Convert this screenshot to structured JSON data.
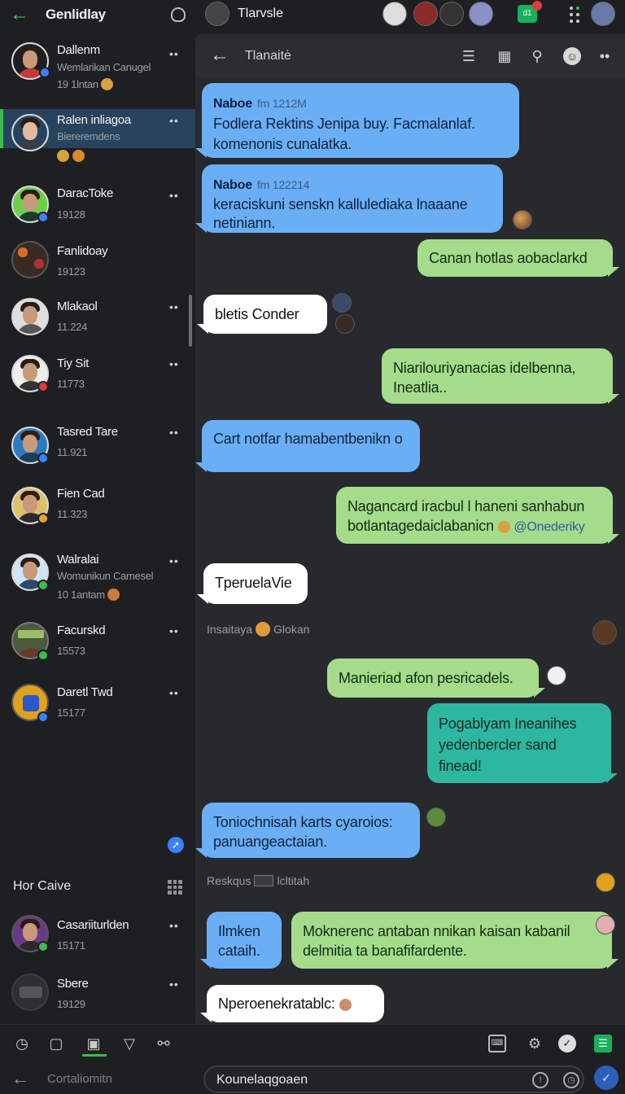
{
  "sidebar": {
    "title": "Genlidlay",
    "contacts": [
      {
        "name": "Dallenm",
        "sub": "Wemlarikan Canugel",
        "meta": "19 1lntan"
      },
      {
        "name": "Ralen inliagoa",
        "sub": "Biereremdens",
        "meta": ""
      },
      {
        "name": "DaracToke",
        "sub": "",
        "meta": "19128"
      },
      {
        "name": "Fanlidoay",
        "sub": "",
        "meta": "19123"
      },
      {
        "name": "Mlakaol",
        "sub": "",
        "meta": "11.224"
      },
      {
        "name": "Tiy Sit",
        "sub": "",
        "meta": "11773"
      },
      {
        "name": "Tasred Tare",
        "sub": "",
        "meta": "11.921"
      },
      {
        "name": "Fien Cad",
        "sub": "",
        "meta": "11.323"
      },
      {
        "name": "Walralai",
        "sub": "Womunikun Camesel",
        "meta": "10 1antam"
      },
      {
        "name": "Facurskd",
        "sub": "",
        "meta": "15573"
      },
      {
        "name": "Daretl Twd",
        "sub": "",
        "meta": "15177"
      },
      {
        "name": "Casariiturlden",
        "sub": "",
        "meta": "15171"
      },
      {
        "name": "Sbere",
        "sub": "",
        "meta": "19129"
      }
    ],
    "section_label": "Hor Caive",
    "more_label": "••"
  },
  "topbar": {
    "title": "Tlarvsle",
    "green_badge": "d1"
  },
  "chat_header": {
    "title": "Tlanaitė"
  },
  "messages": [
    {
      "sender": "Naboe",
      "time": "fm 1212M",
      "text": "Fodlera Rektins Jenipa buy. Facmalanlaf. komenonis cunalatka."
    },
    {
      "sender": "Naboe",
      "time": "fm 122214",
      "text": "keraciskuni senskn kallulediaka lnaaane netiniann."
    },
    {
      "text": "Canan hotlas aobaclarkd"
    },
    {
      "text": "bletis Conder"
    },
    {
      "text": "Niarilouriyanacias idelbenna, Ineatlia.."
    },
    {
      "text": "Cart notfar hamabentbenikn o"
    },
    {
      "text": "Nagancard iracbul l haneni sanhabun botlantagedaiclabanicn",
      "mention": "@Onederiky"
    },
    {
      "text": "TperuelaVie"
    },
    {
      "text": "Manieriad afon pesricadels."
    },
    {
      "text": "Pogablyam Ineanihes yedenbercler sand finead!"
    },
    {
      "text": "Toniochnisah karts cyaroios: panuangeactaian."
    },
    {
      "text": "Ilmken cataih."
    },
    {
      "text": "Moknerenc antaban nnikan kaisan kabanil delmitia ta banafifardente."
    },
    {
      "text": "Nperoenekratablc:"
    }
  ],
  "system_lines": [
    {
      "left": "Insaitaya",
      "right": "Glokan"
    },
    {
      "left": "Reskqus",
      "right": "lcltitah"
    }
  ],
  "input": {
    "left_text": "Cortaliomitn",
    "value": "Kounelaqgoaen"
  },
  "colors": {
    "bubble_blue": "#6aaef6",
    "bubble_green": "#a4dc8b",
    "bubble_teal": "#2eb7a0",
    "accent_green": "#3fb950",
    "accent_blue": "#3b82f6"
  },
  "icons": [
    "back-arrow-icon",
    "person-icon",
    "list-icon",
    "grid-icon",
    "search-icon",
    "emoji-icon",
    "more-icon",
    "send-icon"
  ]
}
